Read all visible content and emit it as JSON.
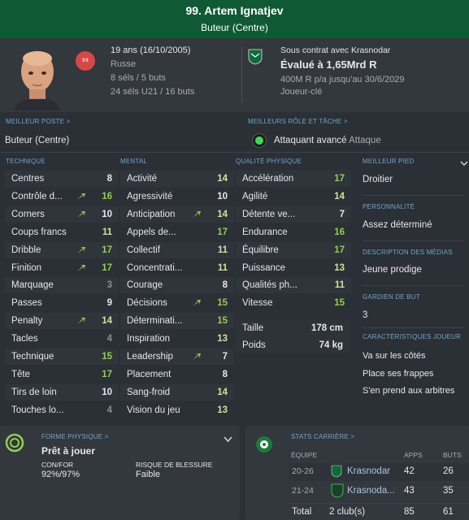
{
  "header": {
    "name": "99. Artem Ignatjev",
    "position": "Buteur (Centre)"
  },
  "profile": {
    "nation_badge": "Int",
    "age_dob": "19 ans (16/10/2005)",
    "nationality": "Russe",
    "caps": "8 séls / 5 buts",
    "u21_caps": "24 séls U21 / 16 buts"
  },
  "contract": {
    "status": "Sous contrat avec Krasnodar",
    "value": "Évalué à 1,65Mrd R",
    "wage": "400M R p/a jusqu'au 30/6/2029",
    "role": "Joueur-clé"
  },
  "best_position": {
    "label": "MEILLEUR POSTE >",
    "value": "Buteur (Centre)"
  },
  "best_role": {
    "label": "MEILLEURS RÔLE ET TÂCHE >",
    "role": "Attaquant avancé",
    "duty": "Attaque"
  },
  "columns": {
    "technical": "TECHNIQUE",
    "mental": "MENTAL",
    "physical": "QUALITÉ PHYSIQUE"
  },
  "technical": [
    {
      "name": "Centres",
      "value": "8",
      "color": "#e6e8ea",
      "up": false
    },
    {
      "name": "Contrôle d...",
      "value": "16",
      "color": "#8fd14f",
      "up": true
    },
    {
      "name": "Corners",
      "value": "10",
      "color": "#e6e8ea",
      "up": true
    },
    {
      "name": "Coups francs",
      "value": "11",
      "color": "#cfe39a",
      "up": false
    },
    {
      "name": "Dribble",
      "value": "17",
      "color": "#8fd14f",
      "up": true
    },
    {
      "name": "Finition",
      "value": "17",
      "color": "#8fd14f",
      "up": true
    },
    {
      "name": "Marquage",
      "value": "3",
      "color": "#8a8f95",
      "up": false
    },
    {
      "name": "Passes",
      "value": "9",
      "color": "#e6e8ea",
      "up": false
    },
    {
      "name": "Penalty",
      "value": "14",
      "color": "#cfe39a",
      "up": true
    },
    {
      "name": "Tacles",
      "value": "4",
      "color": "#8a8f95",
      "up": false
    },
    {
      "name": "Technique",
      "value": "15",
      "color": "#8fd14f",
      "up": false
    },
    {
      "name": "Tête",
      "value": "17",
      "color": "#8fd14f",
      "up": false
    },
    {
      "name": "Tirs de loin",
      "value": "10",
      "color": "#e6e8ea",
      "up": false
    },
    {
      "name": "Touches lo...",
      "value": "4",
      "color": "#8a8f95",
      "up": false
    }
  ],
  "mental": [
    {
      "name": "Activité",
      "value": "14",
      "color": "#cfe39a",
      "up": false
    },
    {
      "name": "Agressivité",
      "value": "10",
      "color": "#e6e8ea",
      "up": false
    },
    {
      "name": "Anticipation",
      "value": "14",
      "color": "#cfe39a",
      "up": true
    },
    {
      "name": "Appels de...",
      "value": "17",
      "color": "#8fd14f",
      "up": false
    },
    {
      "name": "Collectif",
      "value": "11",
      "color": "#cfe39a",
      "up": false
    },
    {
      "name": "Concentrati...",
      "value": "11",
      "color": "#cfe39a",
      "up": false
    },
    {
      "name": "Courage",
      "value": "8",
      "color": "#e6e8ea",
      "up": false
    },
    {
      "name": "Décisions",
      "value": "15",
      "color": "#8fd14f",
      "up": true
    },
    {
      "name": "Déterminati...",
      "value": "15",
      "color": "#8fd14f",
      "up": false
    },
    {
      "name": "Inspiration",
      "value": "13",
      "color": "#cfe39a",
      "up": false
    },
    {
      "name": "Leadership",
      "value": "7",
      "color": "#e6e8ea",
      "up": true
    },
    {
      "name": "Placement",
      "value": "8",
      "color": "#e6e8ea",
      "up": false
    },
    {
      "name": "Sang-froid",
      "value": "14",
      "color": "#cfe39a",
      "up": false
    },
    {
      "name": "Vision du jeu",
      "value": "13",
      "color": "#cfe39a",
      "up": false
    }
  ],
  "physical": [
    {
      "name": "Accélération",
      "value": "17",
      "color": "#8fd14f",
      "up": false
    },
    {
      "name": "Agilité",
      "value": "14",
      "color": "#cfe39a",
      "up": false
    },
    {
      "name": "Détente ve...",
      "value": "7",
      "color": "#e6e8ea",
      "up": false
    },
    {
      "name": "Endurance",
      "value": "16",
      "color": "#8fd14f",
      "up": false
    },
    {
      "name": "Équilibre",
      "value": "17",
      "color": "#8fd14f",
      "up": false
    },
    {
      "name": "Puissance",
      "value": "13",
      "color": "#cfe39a",
      "up": false
    },
    {
      "name": "Qualités ph...",
      "value": "11",
      "color": "#cfe39a",
      "up": false
    },
    {
      "name": "Vitesse",
      "value": "15",
      "color": "#8fd14f",
      "up": false
    }
  ],
  "body": {
    "height_label": "Taille",
    "height": "178 cm",
    "weight_label": "Poids",
    "weight": "74 kg"
  },
  "side": {
    "foot_label": "MEILLEUR PIED",
    "foot": "Droitier",
    "personality_label": "PERSONNALITÉ",
    "personality": "Assez déterminé",
    "media_label": "DESCRIPTION DES MÉDIAS",
    "media": "Jeune prodige",
    "gk_label": "GARDIEN DE BUT",
    "gk": "3",
    "traits_label": "CARACTÉRISTIQUES JOUEUR",
    "traits": [
      "Va sur les côtés",
      "Place ses frappes",
      "S'en prend aux arbitres"
    ]
  },
  "fitness": {
    "label": "FORME PHYSIQUE >",
    "status": "Prêt à jouer",
    "con_label": "CON/FOR",
    "con_value": "92%/97%",
    "risk_label": "RISQUE DE BLESSURE",
    "risk_value": "Faible"
  },
  "career": {
    "label": "STATS CARRIÈRE >",
    "col_team": "ÉQUIPE",
    "col_apps": "APPS",
    "col_goals": "BUTS",
    "rows": [
      {
        "season": "20-26",
        "team": "Krasnodar",
        "apps": "42",
        "goals": "26"
      },
      {
        "season": "21-24",
        "team": "Krasnoda...",
        "apps": "43",
        "goals": "35"
      }
    ],
    "total_label": "Total",
    "total_clubs": "2 club(s)",
    "total_apps": "85",
    "total_goals": "61"
  },
  "colors": {
    "header_green": "#0f5a35",
    "section_blue": "#6fa8c8",
    "good": "#8fd14f"
  }
}
